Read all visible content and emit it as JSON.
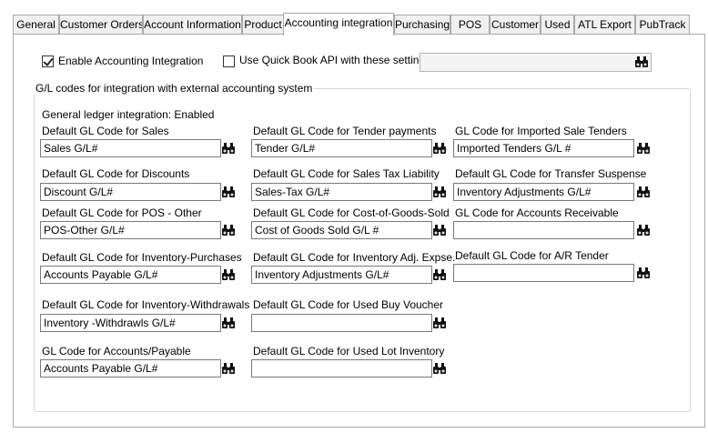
{
  "tabs": [
    {
      "label": "General",
      "active": false
    },
    {
      "label": "Customer Orders",
      "active": false
    },
    {
      "label": "Account Information",
      "active": false
    },
    {
      "label": "Product",
      "active": false
    },
    {
      "label": "Accounting integration",
      "active": true
    },
    {
      "label": "Purchasing",
      "active": false
    },
    {
      "label": "POS",
      "active": false
    },
    {
      "label": "Customer",
      "active": false
    },
    {
      "label": "Used",
      "active": false
    },
    {
      "label": "ATL Export",
      "active": false
    },
    {
      "label": "PubTrack",
      "active": false
    }
  ],
  "options": {
    "enable_integration": {
      "label": "Enable Accounting Integration",
      "checked": true
    },
    "quickbook_api": {
      "label": "Use Quick Book API with these settings",
      "checked": false,
      "value": ""
    }
  },
  "group": {
    "title": "G/L codes for integration with external accounting system",
    "status": "General ledger integration: Enabled",
    "fields": [
      {
        "label": "Default GL Code for Sales",
        "value": "Sales  G/L#"
      },
      {
        "label": "Default GL Code for Tender payments",
        "value": "Tender G/L#"
      },
      {
        "label": "GL Code for Imported Sale Tenders",
        "value": "Imported Tenders G/L #"
      },
      {
        "label": "Default GL Code for Discounts",
        "value": "Discount G/L#"
      },
      {
        "label": "Default GL Code for Sales Tax Liability",
        "value": "Sales-Tax G/L#"
      },
      {
        "label": "Default GL Code for Transfer Suspense",
        "value": "Inventory Adjustments G/L#"
      },
      {
        "label": "Default GL Code for POS - Other",
        "value": "POS-Other G/L#"
      },
      {
        "label": "Default GL Code for Cost-of-Goods-Sold",
        "value": "Cost of Goods Sold G/L #"
      },
      {
        "label": "GL Code for Accounts Receivable",
        "value": ""
      },
      {
        "label": "Default GL Code for Inventory-Purchases",
        "value": "Accounts Payable G/L#"
      },
      {
        "label": "Default GL Code for Inventory Adj. Expse.",
        "value": "Inventory Adjustments G/L#"
      },
      {
        "label": "Default GL Code for A/R Tender",
        "value": ""
      },
      {
        "label": "Default GL Code for Inventory-Withdrawals",
        "value": "Inventory -Withdrawls G/L#"
      },
      {
        "label": "Default GL Code for Used Buy Voucher",
        "value": ""
      },
      {
        "label": "GL Code for Accounts/Payable",
        "value": "Accounts Payable G/L#"
      },
      {
        "label": "Default GL Code for Used Lot Inventory",
        "value": ""
      }
    ]
  },
  "icons": {
    "lookup": "binoculars-icon"
  }
}
